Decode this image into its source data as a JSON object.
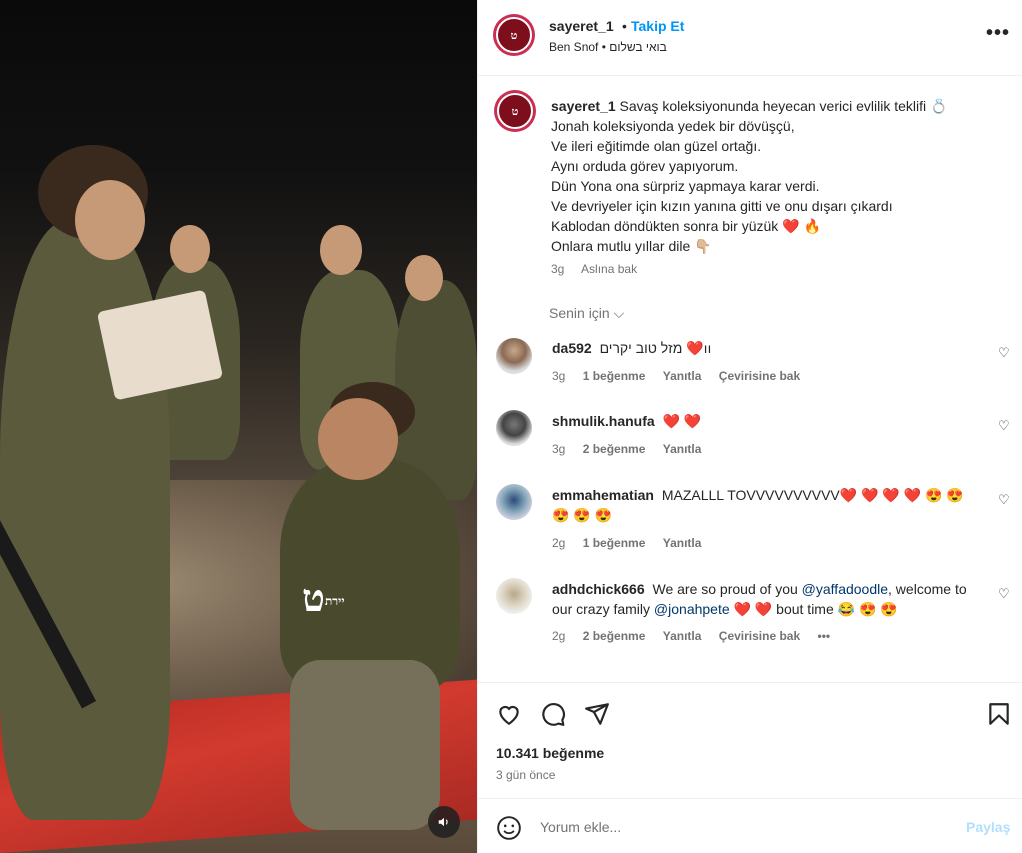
{
  "post": {
    "watermark": "ט",
    "watermark_small": "יירת",
    "mute_icon": "speaker-icon"
  },
  "header": {
    "username": "sayeret_1",
    "separator": "•",
    "follow_label": "Takip Et",
    "subtitle": "Ben Snof • בואי בשלום",
    "more": "•••",
    "avatar_text": "ט"
  },
  "caption": {
    "username": "sayeret_1",
    "lines": [
      "Savaş koleksiyonunda heyecan verici evlilik teklifi 💍",
      "Jonah koleksiyonda yedek bir dövüşçü,",
      "Ve ileri eğitimde olan güzel ortağı.",
      "Aynı orduda görev yapıyorum.",
      "Dün Yona ona sürpriz yapmaya karar verdi.",
      "Ve devriyeler için kızın yanına gitti ve onu dışarı çıkardı",
      "Kablodan döndükten sonra bir yüzük ❤️  🔥",
      "Onlara mutlu yıllar dile 👇🏼"
    ],
    "time": "3g",
    "translate": "Aslına bak"
  },
  "for_you": "Senin için ⌵",
  "comments": [
    {
      "username": "da592",
      "text": "מזל טוב יקרים ❤️ıı",
      "time": "3g",
      "likes": "1 beğenme",
      "reply": "Yanıtla",
      "translate": "Çevirisine bak"
    },
    {
      "username": "shmulik.hanufa",
      "text": "❤️ ❤️",
      "time": "3g",
      "likes": "2 beğenme",
      "reply": "Yanıtla"
    },
    {
      "username": "emmahematian",
      "text": "MAZALLL TOVVVVVVVVVV❤️ ❤️ ❤️ ❤️ 😍 😍 😍 😍 😍",
      "time": "2g",
      "likes": "1 beğenme",
      "reply": "Yanıtla"
    },
    {
      "username": "adhdchick666",
      "text_a": "We are so proud of you ",
      "mention_a": "@yaffadoodle",
      "text_b": ", welcome to our crazy family ",
      "mention_b": "@jonahpete",
      "text_c": " ❤️ ❤️  bout time 😂 😍 😍",
      "time": "2g",
      "likes": "2 beğenme",
      "reply": "Yanıtla",
      "translate": "Çevirisine bak",
      "more": "•••"
    }
  ],
  "actions": {
    "likes": "10.341 beğenme",
    "time": "3 gün önce"
  },
  "comment_box": {
    "placeholder": "Yorum ekle...",
    "post_label": "Paylaş"
  }
}
